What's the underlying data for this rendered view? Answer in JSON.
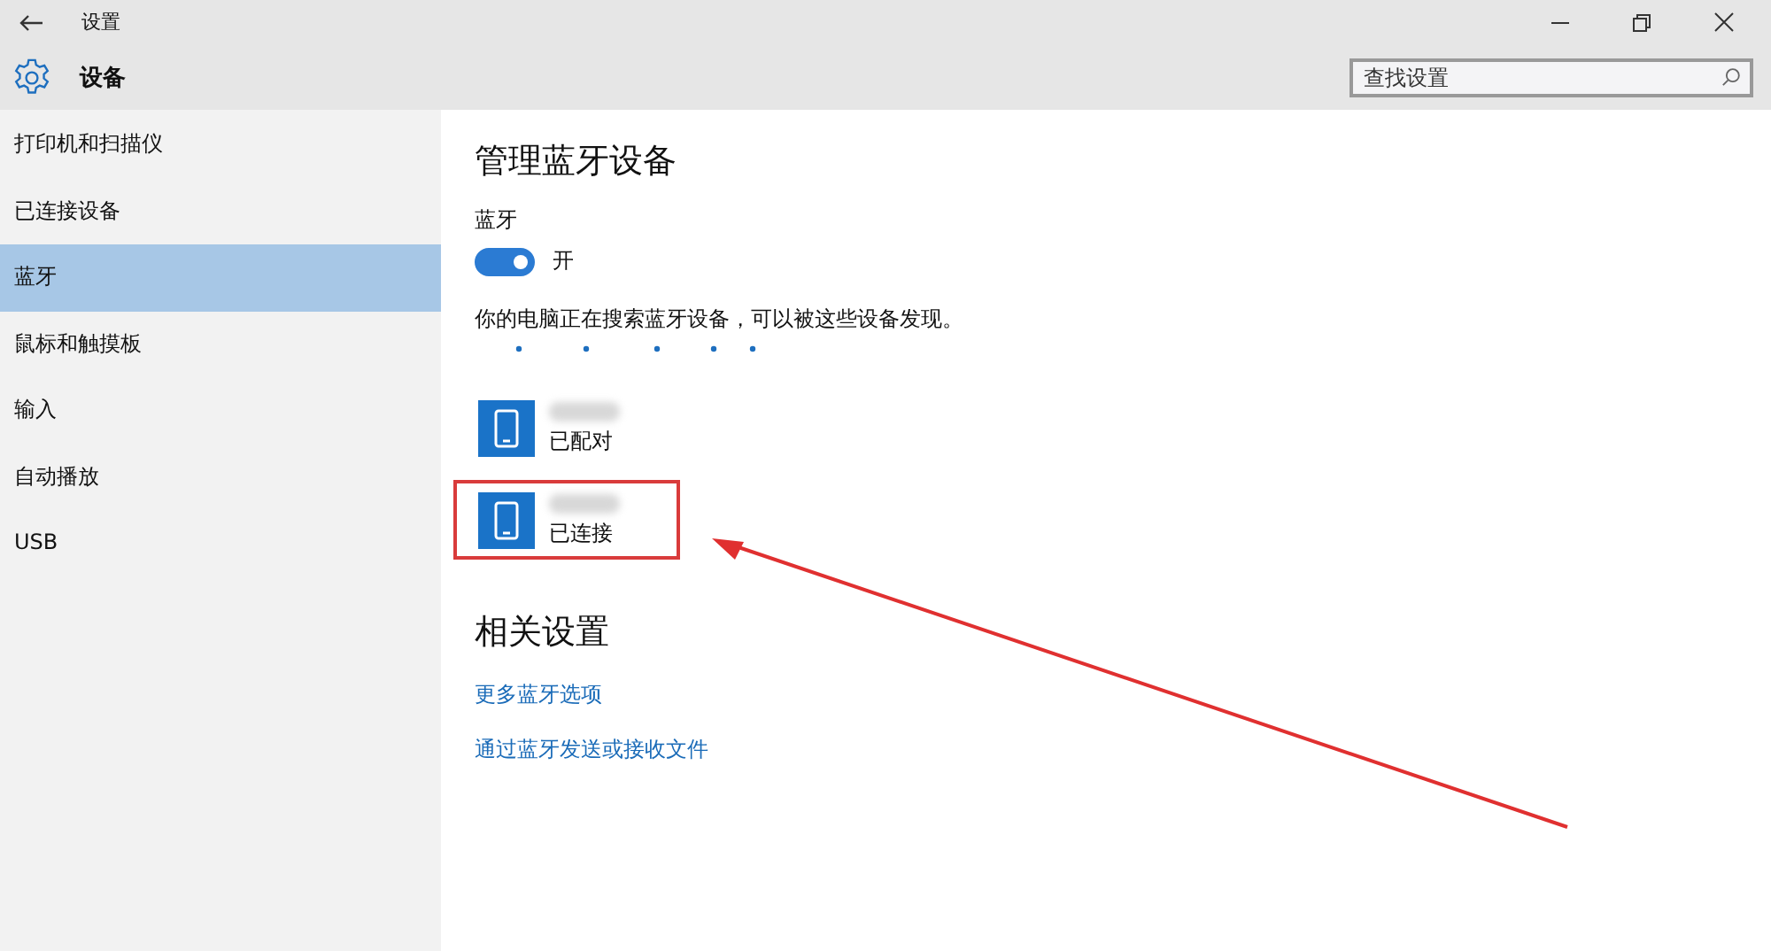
{
  "window": {
    "title": "设置"
  },
  "header": {
    "title": "设备",
    "search": {
      "placeholder": "查找设置"
    }
  },
  "sidebar": {
    "items": [
      {
        "label": "打印机和扫描仪",
        "selected": false
      },
      {
        "label": "已连接设备",
        "selected": false
      },
      {
        "label": "蓝牙",
        "selected": true
      },
      {
        "label": "鼠标和触摸板",
        "selected": false
      },
      {
        "label": "输入",
        "selected": false
      },
      {
        "label": "自动播放",
        "selected": false
      },
      {
        "label": "USB",
        "selected": false
      }
    ]
  },
  "content": {
    "title": "管理蓝牙设备",
    "bluetooth": {
      "label": "蓝牙",
      "on": true,
      "state": "开"
    },
    "status": "你的电脑正在搜索蓝牙设备，可以被这些设备发现。",
    "devices": [
      {
        "status": "已配对",
        "annotated": false
      },
      {
        "status": "已连接",
        "annotated": true
      }
    ],
    "related": {
      "title": "相关设置",
      "links": [
        "更多蓝牙选项",
        "通过蓝牙发送或接收文件"
      ]
    }
  }
}
